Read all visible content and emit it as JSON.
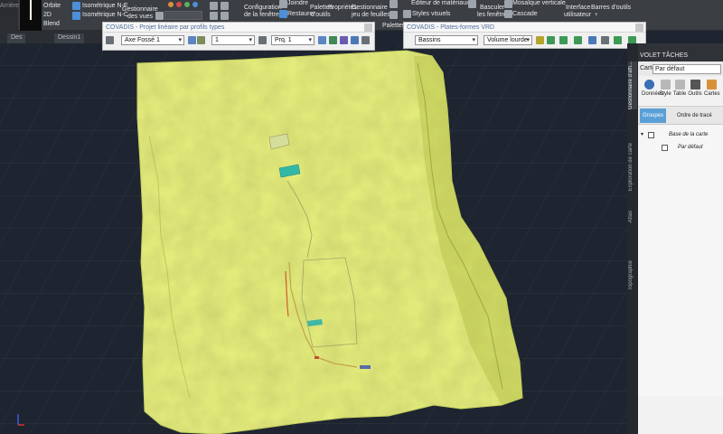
{
  "ribbon": {
    "view_items": {
      "mode_2d": "2D",
      "orbite": "Orbite",
      "iso_ne": "Isométrique N-E",
      "iso_nc": "Isométrique N-C",
      "gest_vues_1": "Gestionnaire",
      "gest_vues_2": "des vues"
    },
    "window_items": {
      "config_1": "Configuration",
      "config_2": "de la fenêtre",
      "joindre": "Joindre",
      "restaurer": "Restaurer",
      "palettes_1": "Palettes",
      "palettes_2": "d'outils",
      "proprietes": "Propriétés",
      "gest_feuilles_1": "Gestionnaire",
      "gest_feuilles_2": "jeu de feuilles",
      "palettes_btn": "Palettes",
      "editeur_materiaux": "Éditeur de matériaux",
      "styles_visuels": "Styles visuels",
      "basculer_1": "Basculer",
      "basculer_2": "les fenêtres",
      "mosaique": "Mosaïque verticale",
      "cascade": "Cascade",
      "interface_1": "Interface",
      "interface_2": "utilisateur",
      "barres_outils": "Barres d'outils"
    }
  },
  "close_tile": {
    "label": "X"
  },
  "doc_tabs": [
    {
      "label": "Des"
    },
    {
      "label": "Dessin1"
    }
  ],
  "toolbar_left": {
    "title": "COVADIS - Projet linéaire par profils types",
    "axe": "Axe Fossé 1",
    "num": "1",
    "prof": "Prq. 1"
  },
  "toolbar_right": {
    "title": "COVADIS - Plates-formes VRD",
    "bassins": "Bassins",
    "volume": "Volume lourde"
  },
  "panel": {
    "vertical_tabs": {
      "gestionnaire": "Gestionnaire d'affi...",
      "exploration": "Exploration de carte",
      "atlas": "Atlas",
      "topographie": "Topographie"
    },
    "header": "VOLET TÂCHES",
    "carte_label": "Carte:",
    "carte_value": "Par défaut",
    "tools": {
      "donnees": "Données",
      "style": "Style",
      "table": "Table",
      "outils": "Outils",
      "cartes": "Cartes"
    },
    "subtabs": {
      "groupes": "Groupes",
      "ordre": "Ordre de tracé"
    },
    "tree": {
      "base": "Base de la carte",
      "defaut": "Par défaut"
    }
  },
  "colors": {
    "background": "#1e2530",
    "terrain": "#e7f07f",
    "ribbon": "#3b3e43",
    "accent": "#5aa0d6"
  }
}
